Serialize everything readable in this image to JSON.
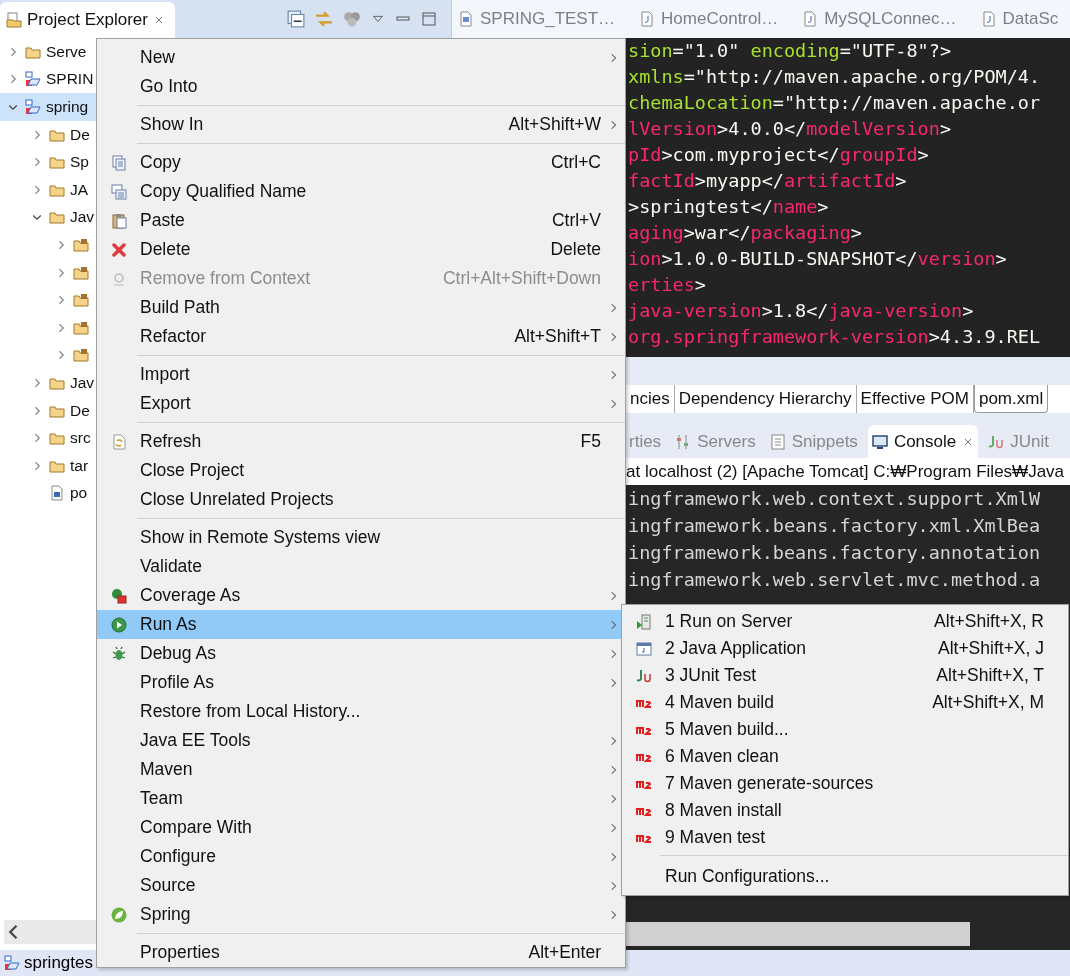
{
  "explorer": {
    "title": "Project Explorer",
    "tree": [
      {
        "label": "Serve",
        "expanded": false,
        "selected": false
      },
      {
        "label": "SPRIN",
        "expanded": false,
        "selected": false
      },
      {
        "label": "spring",
        "expanded": true,
        "selected": true,
        "children": [
          {
            "label": "De",
            "expanded": false,
            "selected": false
          },
          {
            "label": "Sp",
            "expanded": false,
            "selected": false
          },
          {
            "label": "JA",
            "expanded": false,
            "selected": false
          },
          {
            "label": "Jav",
            "expanded": true,
            "selected": false,
            "children": [
              {
                "expanded": false,
                "selected": false
              },
              {
                "expanded": false,
                "selected": false
              },
              {
                "expanded": false,
                "selected": false
              },
              {
                "expanded": false,
                "selected": false
              },
              {
                "expanded": false,
                "selected": false
              }
            ]
          },
          {
            "label": "Jav",
            "expanded": false,
            "selected": false
          },
          {
            "label": "De",
            "expanded": false,
            "selected": false
          },
          {
            "label": "src",
            "expanded": false,
            "selected": false
          },
          {
            "label": "tar",
            "expanded": false,
            "selected": false
          },
          {
            "label": "po",
            "selected": false
          }
        ]
      }
    ]
  },
  "editor_tabs": [
    {
      "label": "SPRING_TEST…"
    },
    {
      "label": "HomeControl…"
    },
    {
      "label": "MySQLConnec…"
    },
    {
      "label": "DataSc"
    }
  ],
  "code_lines": [
    [
      {
        "kind": "attr",
        "text": "sion"
      },
      {
        "kind": "text",
        "text": "=\"1.0\" "
      },
      {
        "kind": "attr",
        "text": "encoding"
      },
      {
        "kind": "text",
        "text": "=\"UTF-8\"?>"
      }
    ],
    [
      {
        "kind": "attr",
        "text": "xmlns"
      },
      {
        "kind": "text",
        "text": "=\"http://maven.apache.org/POM/4."
      }
    ],
    [
      {
        "kind": "attr",
        "text": "chemaLocation"
      },
      {
        "kind": "text",
        "text": "=\"http://maven.apache.or"
      }
    ],
    [
      {
        "kind": "tag",
        "text": "lVersion"
      },
      {
        "kind": "text",
        "text": ">4.0.0</"
      },
      {
        "kind": "tag",
        "text": "modelVersion"
      },
      {
        "kind": "text",
        "text": ">"
      }
    ],
    [
      {
        "kind": "tag",
        "text": "pId"
      },
      {
        "kind": "text",
        "text": ">com.myproject</"
      },
      {
        "kind": "tag",
        "text": "groupId"
      },
      {
        "kind": "text",
        "text": ">"
      }
    ],
    [
      {
        "kind": "tag",
        "text": "factId"
      },
      {
        "kind": "text",
        "text": ">myapp</"
      },
      {
        "kind": "tag",
        "text": "artifactId"
      },
      {
        "kind": "text",
        "text": ">"
      }
    ],
    [
      {
        "kind": "text",
        "text": ">springtest</"
      },
      {
        "kind": "tag",
        "text": "name"
      },
      {
        "kind": "text",
        "text": ">"
      }
    ],
    [
      {
        "kind": "tag",
        "text": "aging"
      },
      {
        "kind": "text",
        "text": ">war</"
      },
      {
        "kind": "tag",
        "text": "packaging"
      },
      {
        "kind": "text",
        "text": ">"
      }
    ],
    [
      {
        "kind": "tag",
        "text": "ion"
      },
      {
        "kind": "text",
        "text": ">1.0.0-BUILD-SNAPSHOT</"
      },
      {
        "kind": "tag",
        "text": "version"
      },
      {
        "kind": "text",
        "text": ">"
      }
    ],
    [
      {
        "kind": "tag",
        "text": "erties"
      },
      {
        "kind": "text",
        "text": ">"
      }
    ],
    [
      {
        "kind": "tag",
        "text": "java-version"
      },
      {
        "kind": "text",
        "text": ">1.8</"
      },
      {
        "kind": "tag",
        "text": "java-version"
      },
      {
        "kind": "text",
        "text": ">"
      }
    ],
    [
      {
        "kind": "tag",
        "text": "org.springframework-version"
      },
      {
        "kind": "text",
        "text": ">4.3.9.REL"
      }
    ]
  ],
  "pom_tabs": [
    {
      "label": "ncies",
      "selected": false
    },
    {
      "label": "Dependency Hierarchy",
      "selected": false
    },
    {
      "label": "Effective POM",
      "selected": false
    },
    {
      "label": "pom.xml",
      "selected": true
    }
  ],
  "view_tabs": [
    {
      "label": "rties",
      "selected": false
    },
    {
      "label": "Servers",
      "selected": false
    },
    {
      "label": "Snippets",
      "selected": false
    },
    {
      "label": "Console",
      "selected": true
    },
    {
      "label": "JUnit",
      "selected": false
    }
  ],
  "console": {
    "header": "at localhost (2) [Apache Tomcat] C:₩Program Files₩Java",
    "lines": [
      "ingframework.web.context.support.XmlW",
      "ingframework.beans.factory.xml.XmlBea",
      "ingframework.beans.factory.annotation",
      "ingframework.web.servlet.mvc.method.a"
    ]
  },
  "context_menu": {
    "items": [
      {
        "kind": "item",
        "label": "New",
        "submenu": true,
        "disabled": false,
        "selected": false
      },
      {
        "kind": "item",
        "label": "Go Into",
        "submenu": false,
        "disabled": false,
        "selected": false
      },
      {
        "kind": "separator"
      },
      {
        "kind": "item",
        "label": "Show In",
        "shortcut": "Alt+Shift+W",
        "submenu": true,
        "disabled": false,
        "selected": false
      },
      {
        "kind": "separator"
      },
      {
        "kind": "item",
        "label": "Copy",
        "shortcut": "Ctrl+C",
        "submenu": false,
        "disabled": false,
        "selected": false
      },
      {
        "kind": "item",
        "label": "Copy Qualified Name",
        "submenu": false,
        "disabled": false,
        "selected": false
      },
      {
        "kind": "item",
        "label": "Paste",
        "shortcut": "Ctrl+V",
        "submenu": false,
        "disabled": false,
        "selected": false
      },
      {
        "kind": "item",
        "label": "Delete",
        "shortcut": "Delete",
        "submenu": false,
        "disabled": false,
        "selected": false
      },
      {
        "kind": "item",
        "label": "Remove from Context",
        "shortcut": "Ctrl+Alt+Shift+Down",
        "submenu": false,
        "disabled": true,
        "selected": false
      },
      {
        "kind": "item",
        "label": "Build Path",
        "submenu": true,
        "disabled": false,
        "selected": false
      },
      {
        "kind": "item",
        "label": "Refactor",
        "shortcut": "Alt+Shift+T",
        "submenu": true,
        "disabled": false,
        "selected": false
      },
      {
        "kind": "separator"
      },
      {
        "kind": "item",
        "label": "Import",
        "submenu": true,
        "disabled": false,
        "selected": false
      },
      {
        "kind": "item",
        "label": "Export",
        "submenu": true,
        "disabled": false,
        "selected": false
      },
      {
        "kind": "separator"
      },
      {
        "kind": "item",
        "label": "Refresh",
        "shortcut": "F5",
        "submenu": false,
        "disabled": false,
        "selected": false
      },
      {
        "kind": "item",
        "label": "Close Project",
        "submenu": false,
        "disabled": false,
        "selected": false
      },
      {
        "kind": "item",
        "label": "Close Unrelated Projects",
        "submenu": false,
        "disabled": false,
        "selected": false
      },
      {
        "kind": "separator"
      },
      {
        "kind": "item",
        "label": "Show in Remote Systems view",
        "submenu": false,
        "disabled": false,
        "selected": false
      },
      {
        "kind": "item",
        "label": "Validate",
        "submenu": false,
        "disabled": false,
        "selected": false
      },
      {
        "kind": "item",
        "label": "Coverage As",
        "submenu": true,
        "disabled": false,
        "selected": false
      },
      {
        "kind": "item",
        "label": "Run As",
        "submenu": true,
        "disabled": false,
        "selected": true
      },
      {
        "kind": "item",
        "label": "Debug As",
        "submenu": true,
        "disabled": false,
        "selected": false
      },
      {
        "kind": "item",
        "label": "Profile As",
        "submenu": true,
        "disabled": false,
        "selected": false
      },
      {
        "kind": "item",
        "label": "Restore from Local History...",
        "submenu": false,
        "disabled": false,
        "selected": false
      },
      {
        "kind": "item",
        "label": "Java EE Tools",
        "submenu": true,
        "disabled": false,
        "selected": false
      },
      {
        "kind": "item",
        "label": "Maven",
        "submenu": true,
        "disabled": false,
        "selected": false
      },
      {
        "kind": "item",
        "label": "Team",
        "submenu": true,
        "disabled": false,
        "selected": false
      },
      {
        "kind": "item",
        "label": "Compare With",
        "submenu": true,
        "disabled": false,
        "selected": false
      },
      {
        "kind": "item",
        "label": "Configure",
        "submenu": true,
        "disabled": false,
        "selected": false
      },
      {
        "kind": "item",
        "label": "Source",
        "submenu": true,
        "disabled": false,
        "selected": false
      },
      {
        "kind": "item",
        "label": "Spring",
        "submenu": true,
        "disabled": false,
        "selected": false
      },
      {
        "kind": "separator"
      },
      {
        "kind": "item",
        "label": "Properties",
        "shortcut": "Alt+Enter",
        "submenu": false,
        "disabled": false,
        "selected": false
      }
    ]
  },
  "run_as_menu": {
    "items": [
      {
        "kind": "item",
        "label": "1 Run on Server",
        "shortcut": "Alt+Shift+X, R"
      },
      {
        "kind": "item",
        "label": "2 Java Application",
        "shortcut": "Alt+Shift+X, J"
      },
      {
        "kind": "item",
        "label": "3 JUnit Test",
        "shortcut": "Alt+Shift+X, T"
      },
      {
        "kind": "item",
        "label": "4 Maven build",
        "shortcut": "Alt+Shift+X, M"
      },
      {
        "kind": "item",
        "label": "5 Maven build..."
      },
      {
        "kind": "item",
        "label": "6 Maven clean"
      },
      {
        "kind": "item",
        "label": "7 Maven generate-sources"
      },
      {
        "kind": "item",
        "label": "8 Maven install"
      },
      {
        "kind": "item",
        "label": "9 Maven test"
      },
      {
        "kind": "separator"
      },
      {
        "kind": "item",
        "label": "Run Configurations..."
      }
    ]
  },
  "status_bar": {
    "text": "springtes"
  }
}
